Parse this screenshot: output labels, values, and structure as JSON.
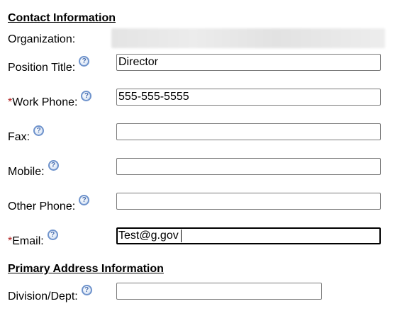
{
  "contact_section": {
    "title": "Contact Information",
    "organization_label": "Organization:",
    "position_title_label": "Position Title:",
    "position_title_value": "Director",
    "work_phone_required_mark": "*",
    "work_phone_label": "Work Phone:",
    "work_phone_value": "555-555-5555",
    "fax_label": "Fax:",
    "fax_value": "",
    "mobile_label": "Mobile:",
    "mobile_value": "",
    "other_phone_label": "Other Phone:",
    "other_phone_value": "",
    "email_required_mark": "*",
    "email_label": "Email:",
    "email_value": "Test@g.gov"
  },
  "address_section": {
    "title": "Primary Address Information",
    "division_label": "Division/Dept:",
    "division_value": ""
  },
  "help_icon": {
    "glyph": "?",
    "icon_name": "help-question-icon"
  },
  "colors": {
    "required_mark": "#b22222",
    "help_icon_ring": "#6f93cc"
  }
}
